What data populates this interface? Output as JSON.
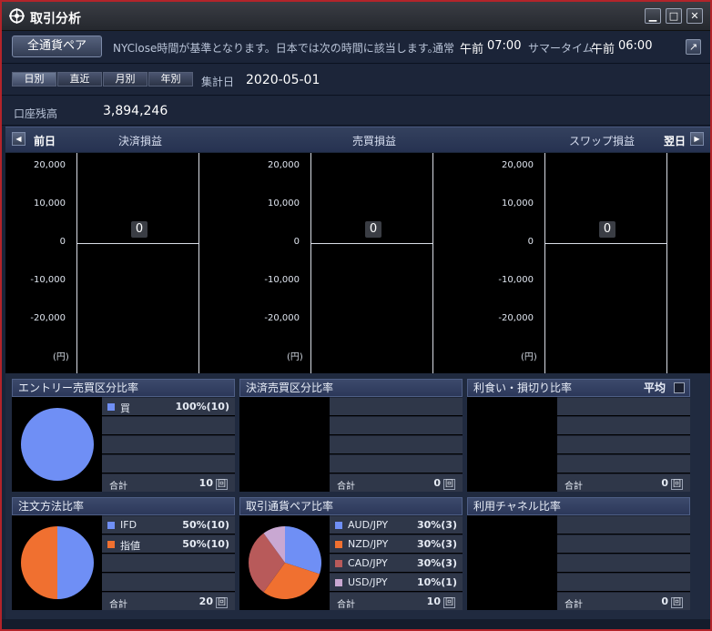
{
  "window": {
    "title": "取引分析",
    "buttons": {
      "minimize": "▁",
      "maximize": "□",
      "close": "✕"
    }
  },
  "toolbar": {
    "pair_button": "全通貨ペア",
    "note": "NYClose時間が基準となります。日本では次の時間に該当します。",
    "normal_label": "通常",
    "normal_ampm": "午前",
    "normal_time": "07:00",
    "summer_label": "サマータイム",
    "summer_ampm": "午前",
    "summer_time": "06:00"
  },
  "period": {
    "tabs": [
      "日別",
      "直近",
      "月別",
      "年別"
    ],
    "selected": "日別",
    "date_label": "集計日",
    "date_value": "2020-05-01"
  },
  "balance": {
    "label": "口座残高",
    "value": "3,894,246"
  },
  "chart_header": {
    "prev": "前日",
    "next": "翌日",
    "titles": [
      "決済損益",
      "売買損益",
      "スワップ損益"
    ]
  },
  "chart_data": [
    {
      "type": "bar",
      "title": "決済損益",
      "categories": [
        ""
      ],
      "values": [
        0
      ],
      "ylim": [
        -20000,
        20000
      ],
      "yticks": [
        "20,000",
        "10,000",
        "0",
        "-10,000",
        "-20,000"
      ],
      "unit": "(円)",
      "value_label": "0"
    },
    {
      "type": "bar",
      "title": "売買損益",
      "categories": [
        ""
      ],
      "values": [
        0
      ],
      "ylim": [
        -20000,
        20000
      ],
      "yticks": [
        "20,000",
        "10,000",
        "0",
        "-10,000",
        "-20,000"
      ],
      "unit": "(円)",
      "value_label": "0"
    },
    {
      "type": "bar",
      "title": "スワップ損益",
      "categories": [
        ""
      ],
      "values": [
        0
      ],
      "ylim": [
        -20000,
        20000
      ],
      "yticks": [
        "20,000",
        "10,000",
        "0",
        "-10,000",
        "-20,000"
      ],
      "unit": "(円)",
      "value_label": "0"
    },
    {
      "type": "pie",
      "title": "エントリー売買区分比率",
      "categories": [
        "買"
      ],
      "values": [
        100
      ],
      "colors": [
        "#6f8ff5"
      ]
    },
    {
      "type": "pie",
      "title": "注文方法比率",
      "categories": [
        "IFD",
        "指値"
      ],
      "values": [
        50,
        50
      ],
      "colors": [
        "#6f8ff5",
        "#f07030"
      ]
    },
    {
      "type": "pie",
      "title": "取引通貨ペア比率",
      "categories": [
        "AUD/JPY",
        "NZD/JPY",
        "CAD/JPY",
        "USD/JPY"
      ],
      "values": [
        30,
        30,
        30,
        10
      ],
      "colors": [
        "#6f8ff5",
        "#f07030",
        "#b85a5a",
        "#c9a8d2"
      ]
    }
  ],
  "panels": [
    {
      "title": "エントリー売買区分比率",
      "rows": [
        {
          "label": "買",
          "value": "100%(10)",
          "color": "#6f8ff5"
        }
      ],
      "total_label": "合計",
      "total_value": "10",
      "unit": "回"
    },
    {
      "title": "決済売買区分比率",
      "rows": [],
      "total_label": "合計",
      "total_value": "0",
      "unit": "回"
    },
    {
      "title": "利食い・損切り比率",
      "extra": "平均",
      "rows": [],
      "total_label": "合計",
      "total_value": "0",
      "unit": "回"
    },
    {
      "title": "注文方法比率",
      "rows": [
        {
          "label": "IFD",
          "value": "50%(10)",
          "color": "#6f8ff5"
        },
        {
          "label": "指値",
          "value": "50%(10)",
          "color": "#f07030"
        }
      ],
      "total_label": "合計",
      "total_value": "20",
      "unit": "回"
    },
    {
      "title": "取引通貨ペア比率",
      "rows": [
        {
          "label": "AUD/JPY",
          "value": "30%(3)",
          "color": "#6f8ff5"
        },
        {
          "label": "NZD/JPY",
          "value": "30%(3)",
          "color": "#f07030"
        },
        {
          "label": "CAD/JPY",
          "value": "30%(3)",
          "color": "#b85a5a"
        },
        {
          "label": "USD/JPY",
          "value": "10%(1)",
          "color": "#c9a8d2"
        }
      ],
      "total_label": "合計",
      "total_value": "10",
      "unit": "回"
    },
    {
      "title": "利用チャネル比率",
      "rows": [],
      "total_label": "合計",
      "total_value": "0",
      "unit": "回"
    }
  ]
}
